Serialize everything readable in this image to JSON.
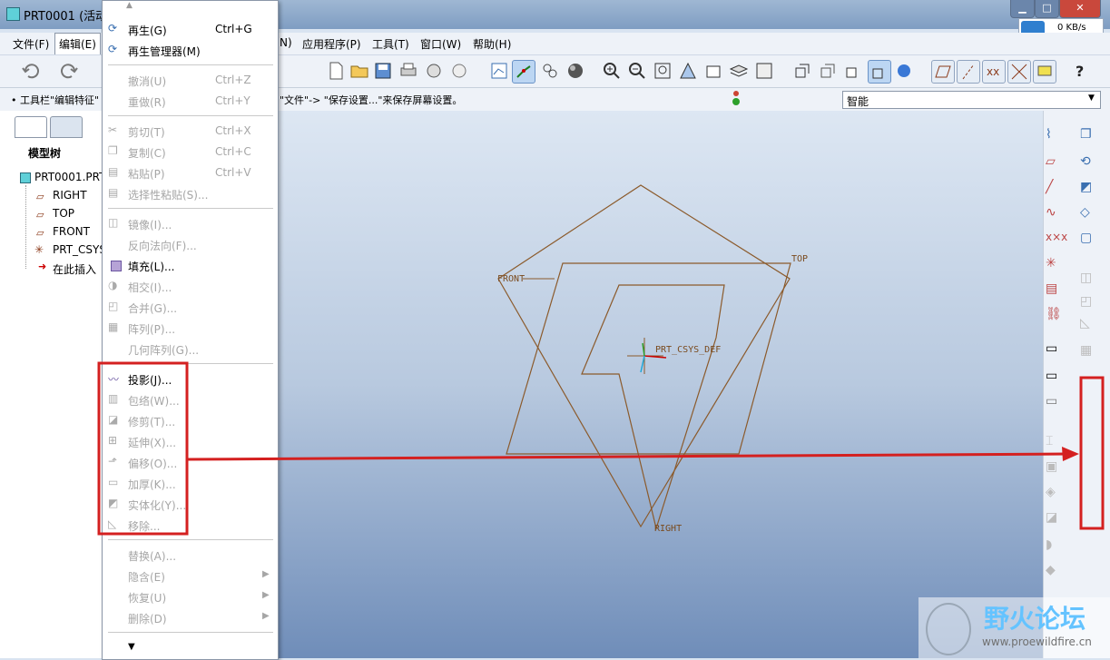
{
  "window": {
    "title": "PRT0001 (活动",
    "net_speed": "0 KB/s"
  },
  "menubar": {
    "items": [
      "文件(F)",
      "编辑(E)",
      "N)",
      "应用程序(P)",
      "工具(T)",
      "窗口(W)",
      "帮助(H)"
    ]
  },
  "message": {
    "left": "• 工具栏\"编辑特征\"",
    "right": "\"文件\"-> \"保存设置...\"来保存屏幕设置。"
  },
  "filter": {
    "value": "智能"
  },
  "model_tree": {
    "header": "模型树",
    "items": [
      "PRT0001.PRT",
      "RIGHT",
      "TOP",
      "FRONT",
      "PRT_CSYS",
      "在此插入"
    ]
  },
  "edit_menu": {
    "items": [
      {
        "label": "再生(G)",
        "shortcut": "Ctrl+G",
        "enabled": true
      },
      {
        "label": "再生管理器(M)",
        "shortcut": "",
        "enabled": true
      },
      {
        "label": "撤消(U)",
        "shortcut": "Ctrl+Z",
        "enabled": false
      },
      {
        "label": "重做(R)",
        "shortcut": "Ctrl+Y",
        "enabled": false
      },
      {
        "label": "剪切(T)",
        "shortcut": "Ctrl+X",
        "enabled": false
      },
      {
        "label": "复制(C)",
        "shortcut": "Ctrl+C",
        "enabled": false
      },
      {
        "label": "粘贴(P)",
        "shortcut": "Ctrl+V",
        "enabled": false
      },
      {
        "label": "选择性粘贴(S)...",
        "shortcut": "",
        "enabled": false
      },
      {
        "label": "镜像(I)...",
        "shortcut": "",
        "enabled": false
      },
      {
        "label": "反向法向(F)...",
        "shortcut": "",
        "enabled": false
      },
      {
        "label": "填充(L)...",
        "shortcut": "",
        "enabled": true
      },
      {
        "label": "相交(I)...",
        "shortcut": "",
        "enabled": false
      },
      {
        "label": "合并(G)...",
        "shortcut": "",
        "enabled": false
      },
      {
        "label": "阵列(P)...",
        "shortcut": "",
        "enabled": false
      },
      {
        "label": "几何阵列(G)...",
        "shortcut": "",
        "enabled": false
      },
      {
        "label": "投影(J)...",
        "shortcut": "",
        "enabled": true
      },
      {
        "label": "包络(W)...",
        "shortcut": "",
        "enabled": false
      },
      {
        "label": "修剪(T)...",
        "shortcut": "",
        "enabled": false
      },
      {
        "label": "延伸(X)...",
        "shortcut": "",
        "enabled": false
      },
      {
        "label": "偏移(O)...",
        "shortcut": "",
        "enabled": false
      },
      {
        "label": "加厚(K)...",
        "shortcut": "",
        "enabled": false
      },
      {
        "label": "实体化(Y)...",
        "shortcut": "",
        "enabled": false
      },
      {
        "label": "移除...",
        "shortcut": "",
        "enabled": false
      },
      {
        "label": "替换(A)...",
        "shortcut": "",
        "enabled": false
      },
      {
        "label": "隐含(E)",
        "shortcut": "",
        "enabled": false
      },
      {
        "label": "恢复(U)",
        "shortcut": "",
        "enabled": false
      },
      {
        "label": "删除(D)",
        "shortcut": "",
        "enabled": false
      }
    ]
  },
  "viewport": {
    "labels": {
      "front": "FRONT",
      "top": "TOP",
      "right": "RIGHT",
      "csys": "PRT_CSYS_DEF"
    }
  },
  "watermark": {
    "text": "野火论坛",
    "url": "www.proewildfire.cn"
  },
  "colors": {
    "annotation": "#d42020",
    "datum": "#8b5a2b"
  }
}
